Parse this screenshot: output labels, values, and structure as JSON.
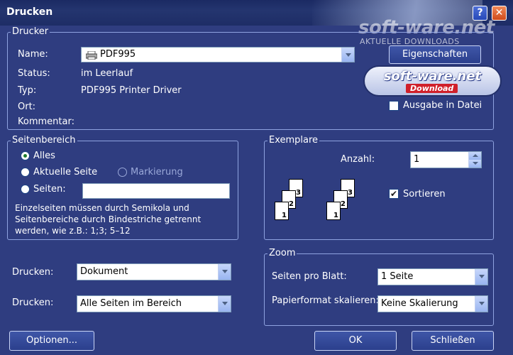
{
  "window": {
    "title": "Drucken",
    "help_glyph": "?",
    "close_glyph": "✕"
  },
  "watermark": {
    "text": "soft-ware.net",
    "sub": "AKTUELLE DOWNLOADS",
    "badge_main": "soft-ware.net",
    "badge_sub": "Download"
  },
  "drucker": {
    "legend": "Drucker",
    "name_label": "Name:",
    "name_value": "PDF995",
    "properties_button": "Eigenschaften",
    "status_label": "Status:",
    "status_value": "im Leerlauf",
    "typ_label": "Typ:",
    "typ_value": "PDF995 Printer Driver",
    "ort_label": "Ort:",
    "kommentar_label": "Kommentar:",
    "print_to_file_label": "Ausgabe in Datei",
    "print_to_file_checked": false
  },
  "seitenbereich": {
    "legend": "Seitenbereich",
    "options": [
      "Alles",
      "Aktuelle Seite",
      "Markierung",
      "Seiten:"
    ],
    "selected": "Alles",
    "pages_value": "",
    "hint_lines": [
      "Einzelseiten müssen durch Semikola und",
      "Seitenbereiche durch Bindestriche getrennt",
      "werden, wie z.B.: 1;3; 5–12"
    ]
  },
  "exemplare": {
    "legend": "Exemplare",
    "count_label": "Anzahl:",
    "count_value": "1",
    "collate_label": "Sortieren",
    "collate_checked": true,
    "page_numbers": [
      "3",
      "2",
      "1"
    ]
  },
  "drucken_left": {
    "label1": "Drucken:",
    "value1": "Dokument",
    "label2": "Drucken:",
    "value2": "Alle Seiten im Bereich"
  },
  "zoom": {
    "legend": "Zoom",
    "pages_per_sheet_label": "Seiten pro Blatt:",
    "pages_per_sheet_value": "1 Seite",
    "scale_label": "Papierformat skalieren:",
    "scale_value": "Keine Skalierung"
  },
  "buttons": {
    "options": "Optionen...",
    "ok": "OK",
    "close": "Schließen"
  },
  "colors": {
    "dialog_bg": "#2f3d80",
    "titlebar": "#1e2d66",
    "group_border": "#8fa3e0",
    "close_button": "#d04a1a"
  }
}
